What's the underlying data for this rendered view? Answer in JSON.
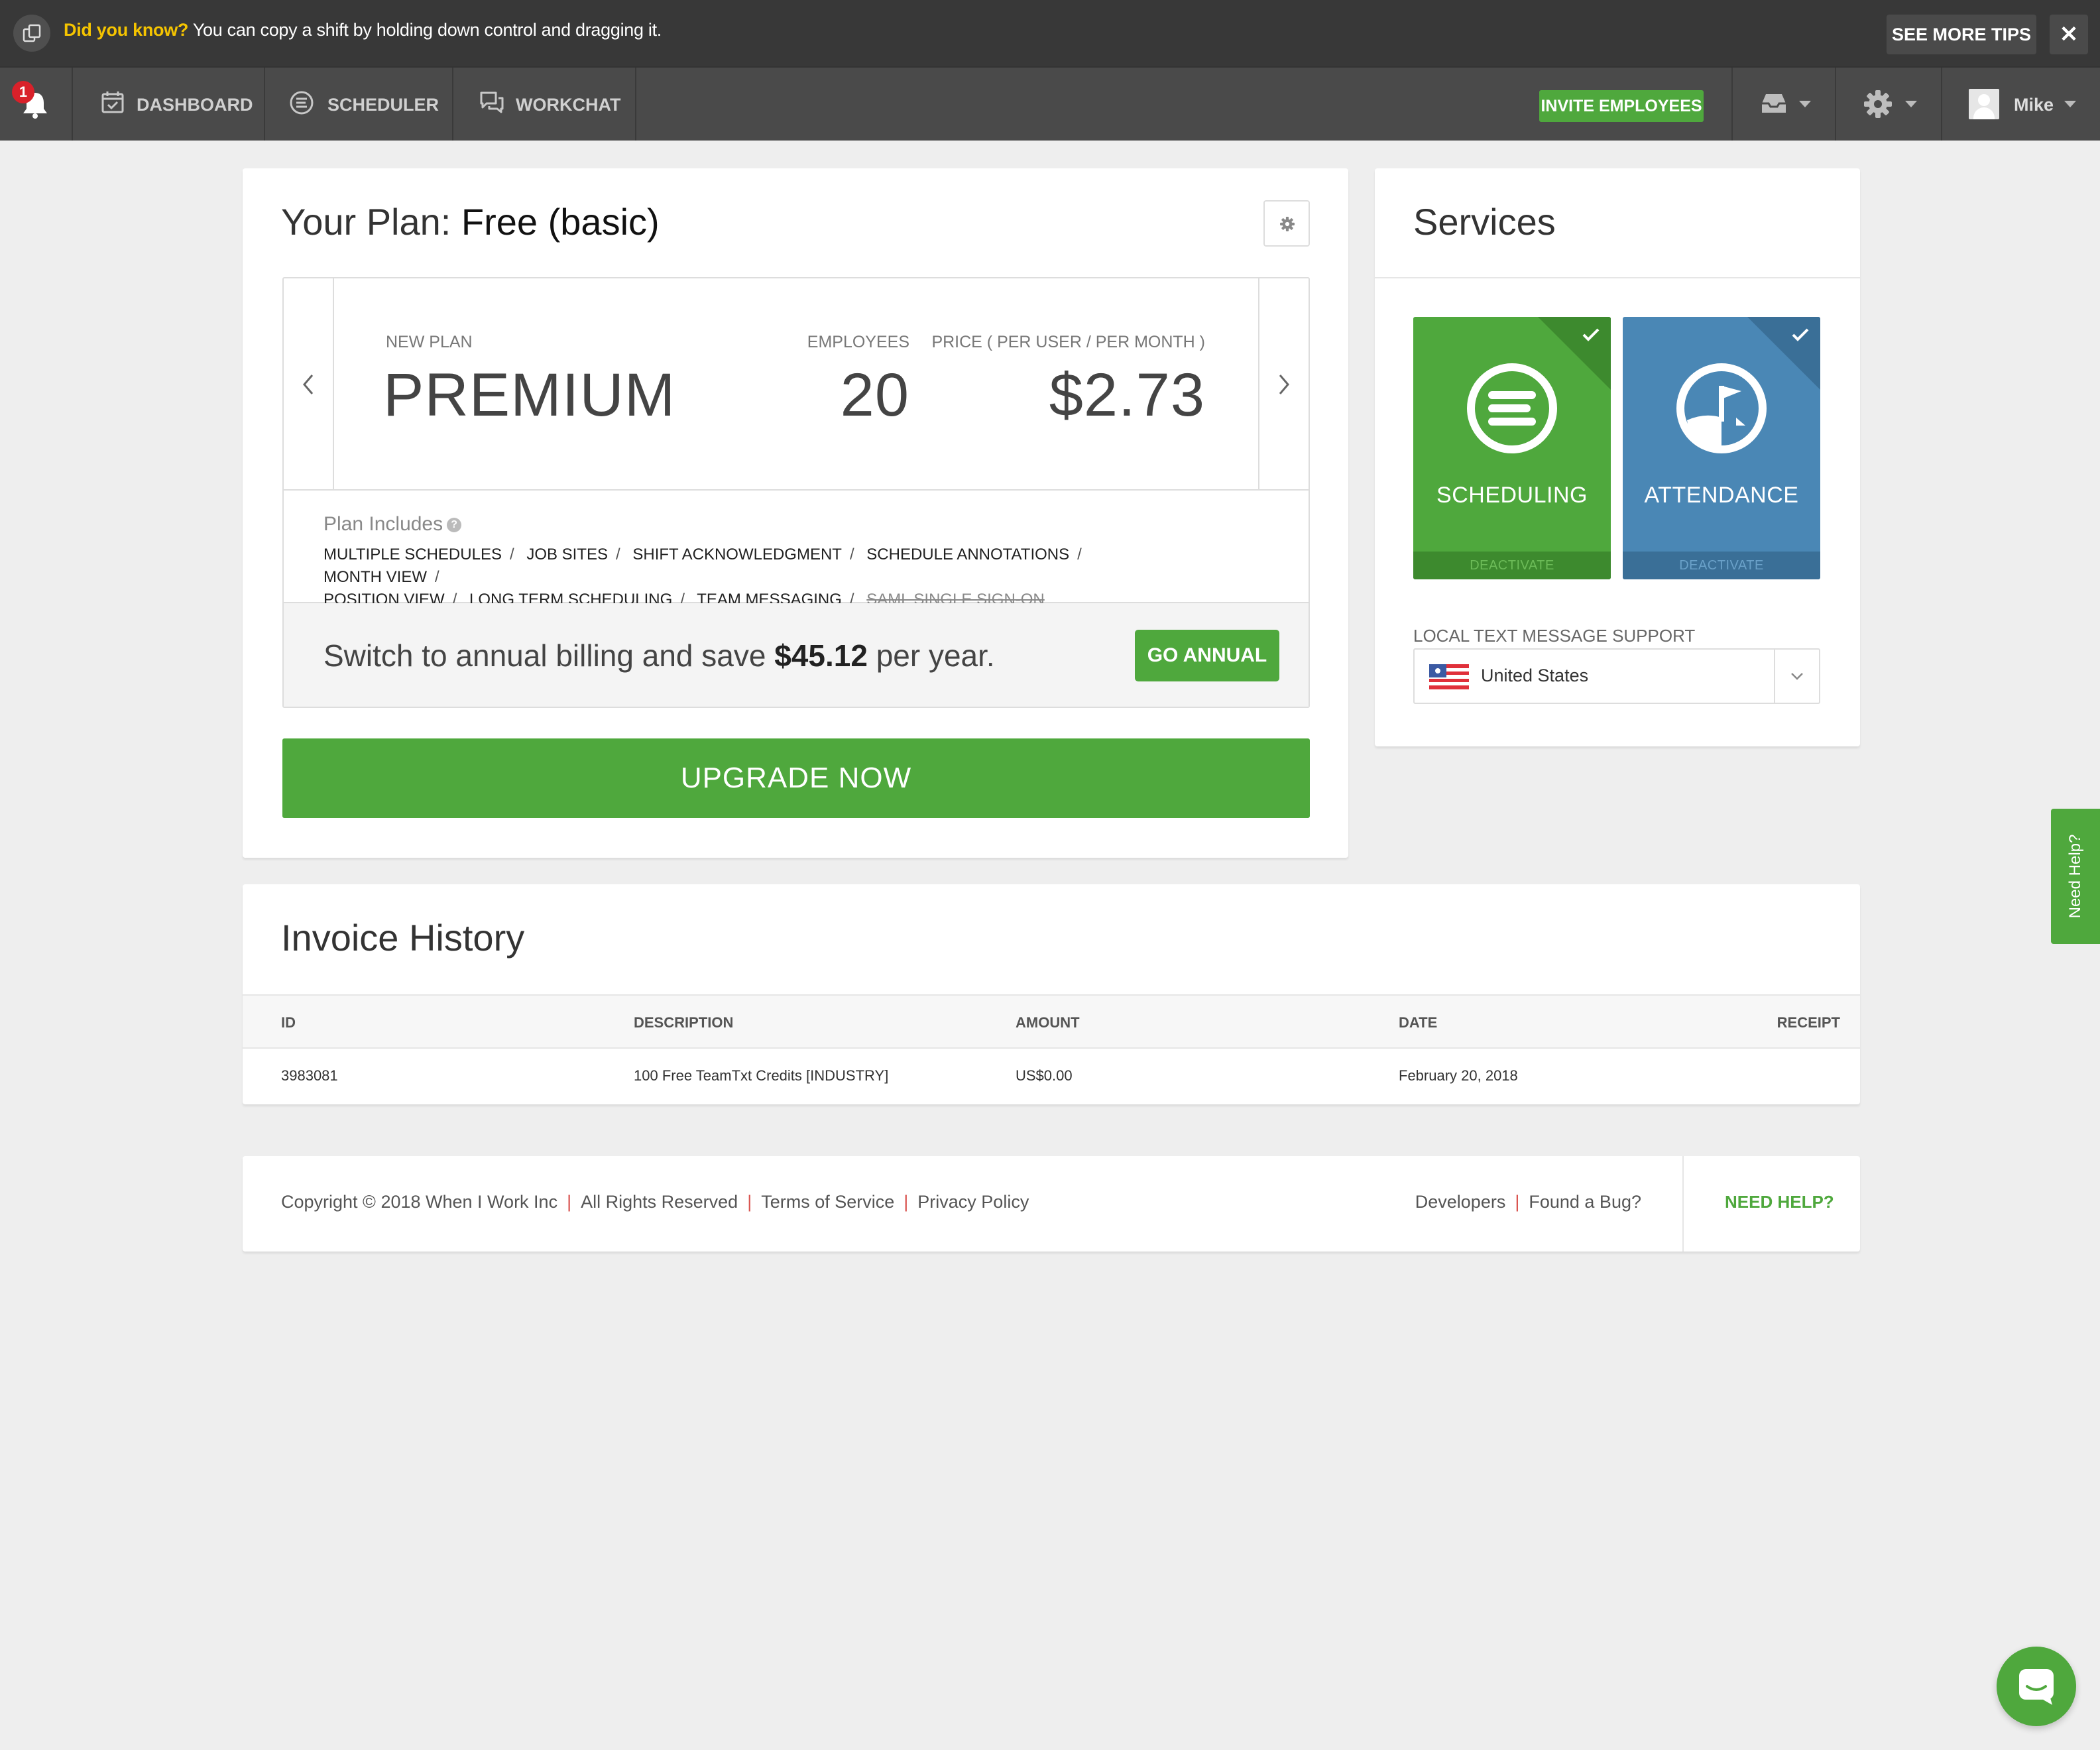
{
  "tipbar": {
    "label": "Did you know?",
    "text": "You can copy a shift by holding down control and dragging it.",
    "more_button": "SEE MORE TIPS",
    "close": "✕"
  },
  "nav": {
    "notification_count": "1",
    "items": [
      {
        "label": "DASHBOARD",
        "icon": "calendar-check-icon"
      },
      {
        "label": "SCHEDULER",
        "icon": "scheduler-icon"
      },
      {
        "label": "WORKCHAT",
        "icon": "chat-bubbles-icon"
      }
    ],
    "invite_button": "INVITE EMPLOYEES",
    "user_name": "Mike"
  },
  "plan": {
    "title_prefix": "Your Plan:",
    "title_value": "Free (basic)",
    "new_plan_label": "NEW PLAN",
    "new_plan_value": "PREMIUM",
    "employees_label": "EMPLOYEES",
    "employees_value": "20",
    "price_label": "PRICE ( PER USER / PER MONTH )",
    "price_value": "$2.73",
    "includes_title": "Plan Includes",
    "features": [
      "MULTIPLE SCHEDULES",
      "JOB SITES",
      "SHIFT ACKNOWLEDGMENT",
      "SCHEDULE ANNOTATIONS",
      "MONTH VIEW",
      "POSITION VIEW",
      "LONG TERM SCHEDULING",
      "TEAM MESSAGING"
    ],
    "disabled_feature": "SAML SINGLE SIGN-ON",
    "annual_text_pre": "Switch to annual billing and save",
    "annual_amount": "$45.12",
    "annual_text_post": "per year.",
    "go_annual_button": "GO ANNUAL",
    "upgrade_button": "UPGRADE NOW"
  },
  "services": {
    "title": "Services",
    "tiles": [
      {
        "name": "SCHEDULING",
        "action": "DEACTIVATE",
        "color": "#4fa83d"
      },
      {
        "name": "ATTENDANCE",
        "action": "DEACTIVATE",
        "color": "#4a87b5"
      }
    ],
    "sms_label": "LOCAL TEXT MESSAGE SUPPORT",
    "country": "United States"
  },
  "invoices": {
    "title": "Invoice History",
    "columns": [
      "ID",
      "DESCRIPTION",
      "AMOUNT",
      "DATE",
      "RECEIPT"
    ],
    "rows": [
      {
        "id": "3983081",
        "description": "100 Free TeamTxt Credits [INDUSTRY]",
        "amount": "US$0.00",
        "date": "February 20, 2018",
        "receipt": ""
      }
    ]
  },
  "footer": {
    "copyright": "Copyright © 2018 When I Work Inc",
    "rights": "All Rights Reserved",
    "terms": "Terms of Service",
    "privacy": "Privacy Policy",
    "developers": "Developers",
    "bug": "Found a Bug?",
    "help": "NEED HELP?"
  },
  "side_help": "Need Help?",
  "colors": {
    "accent": "#4fa83d",
    "attendance": "#4a87b5",
    "nav": "#4a4a4a",
    "tipbar": "#383838"
  }
}
